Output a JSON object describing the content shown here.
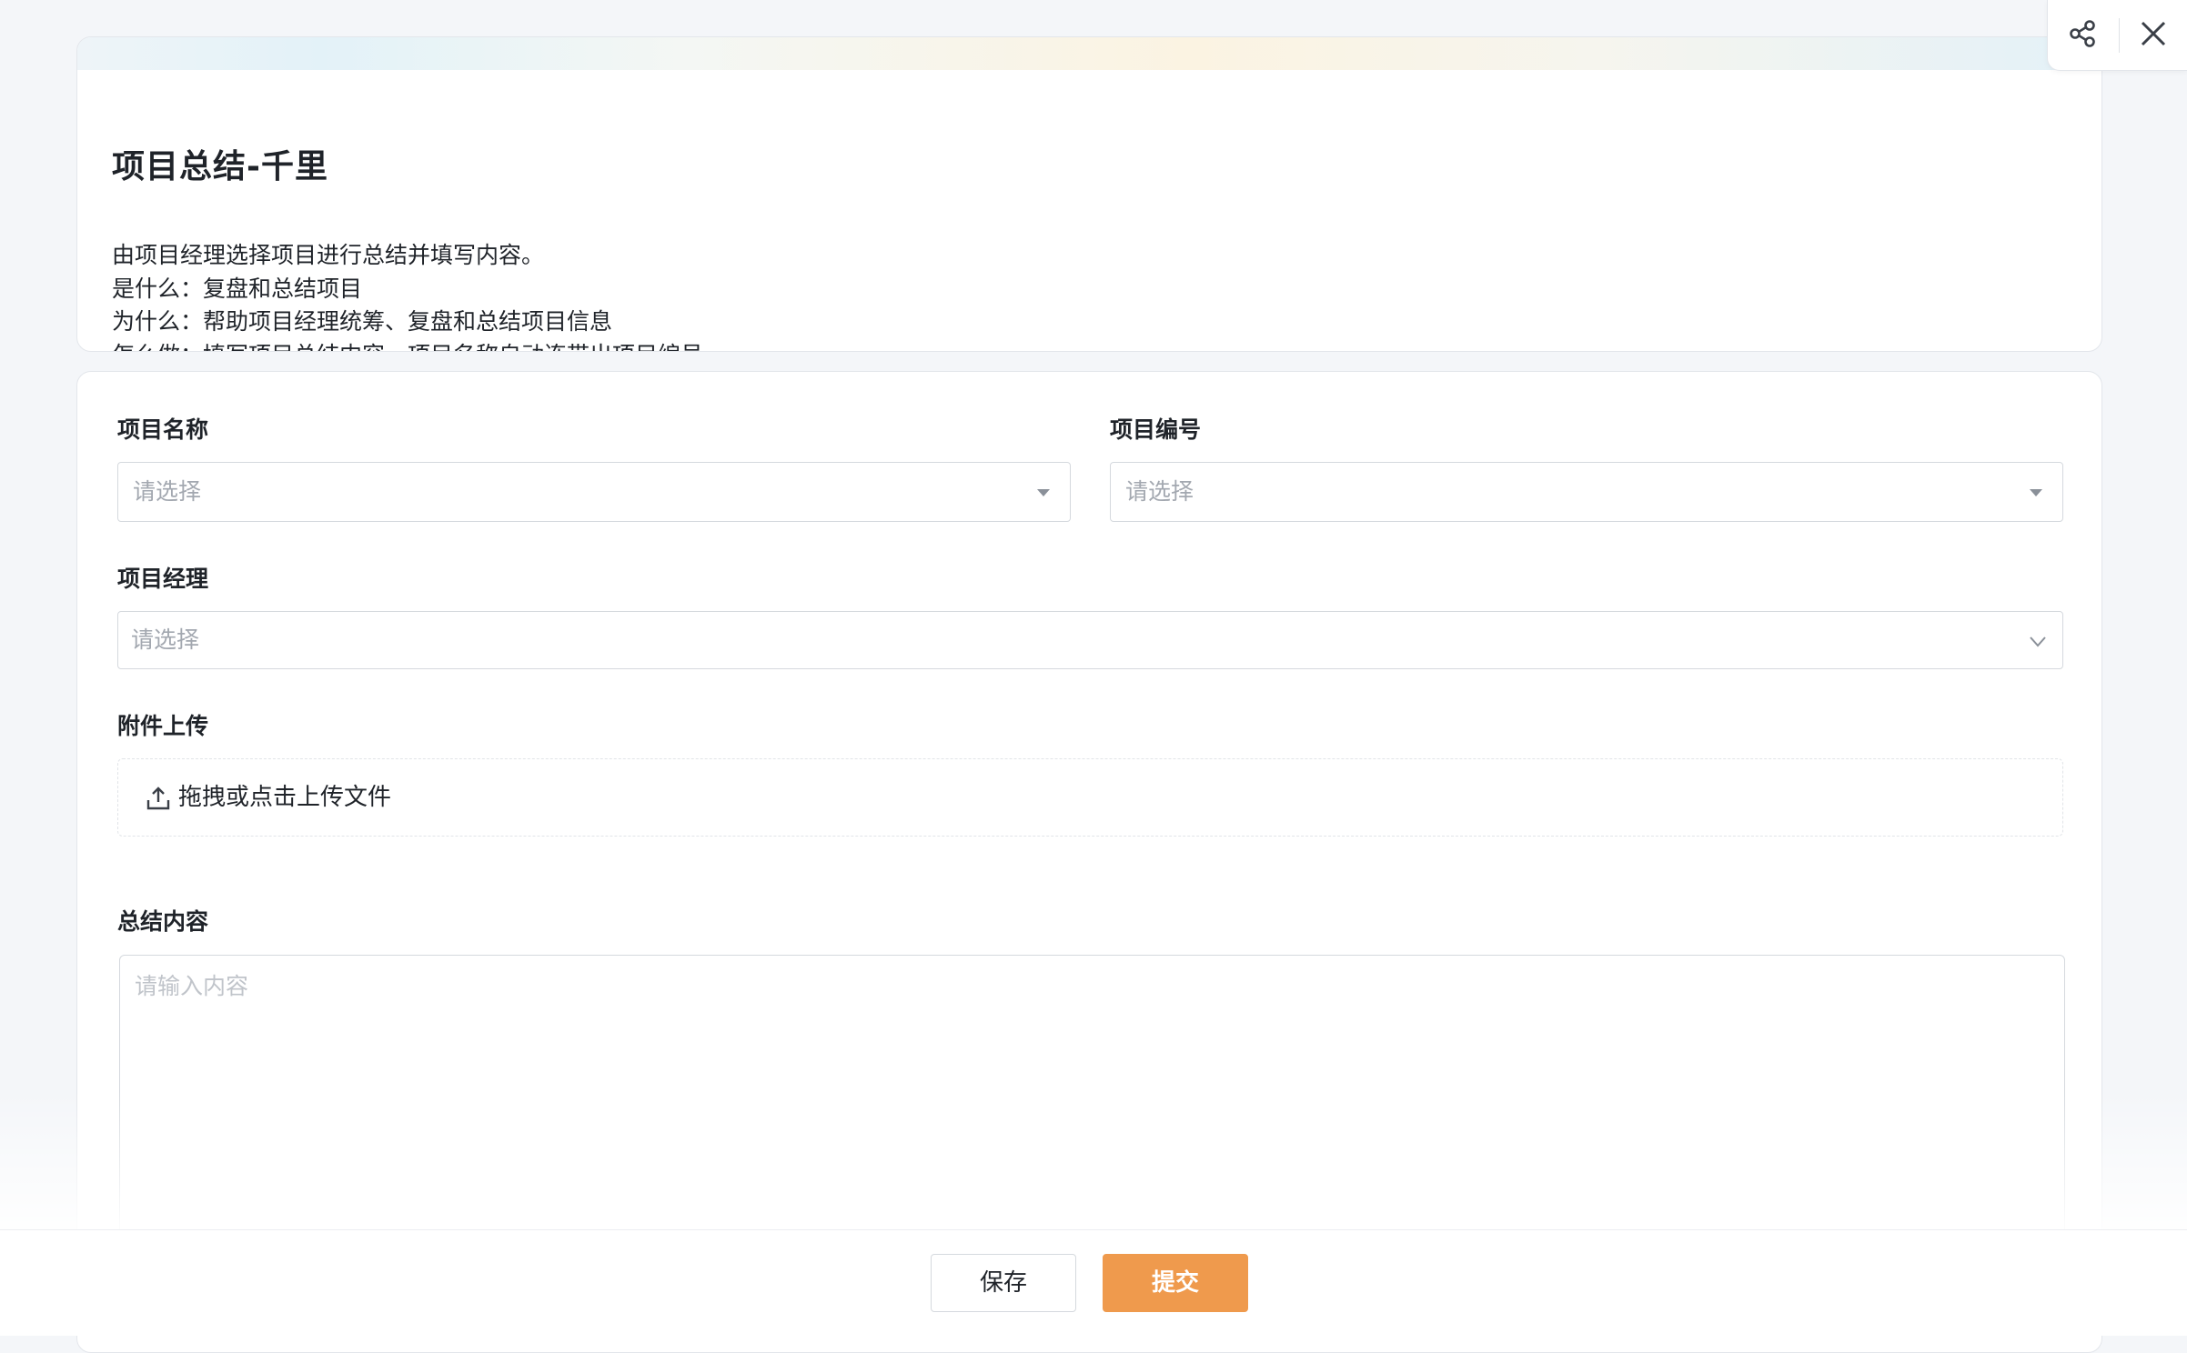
{
  "header": {
    "title": "项目总结-千里",
    "description": [
      "由项目经理选择项目进行总结并填写内容。",
      "是什么：复盘和总结项目",
      "为什么：帮助项目经理统筹、复盘和总结项目信息",
      "怎么做：填写项目总结内容，项目名称自动连带出项目编号"
    ]
  },
  "toolbar": {
    "share_icon": "share-icon",
    "close_icon": "close-icon"
  },
  "form": {
    "project_name": {
      "label": "项目名称",
      "placeholder": "请选择"
    },
    "project_code": {
      "label": "项目编号",
      "placeholder": "请选择"
    },
    "project_manager": {
      "label": "项目经理",
      "placeholder": "请选择"
    },
    "attachment": {
      "label": "附件上传",
      "upload_text": "拖拽或点击上传文件"
    },
    "summary": {
      "label": "总结内容",
      "placeholder": "请输入内容"
    }
  },
  "footer": {
    "save_label": "保存",
    "submit_label": "提交"
  },
  "colors": {
    "accent": "#ef9a4d",
    "page_bg": "#f4f6f9",
    "border": "#d5d9de"
  }
}
